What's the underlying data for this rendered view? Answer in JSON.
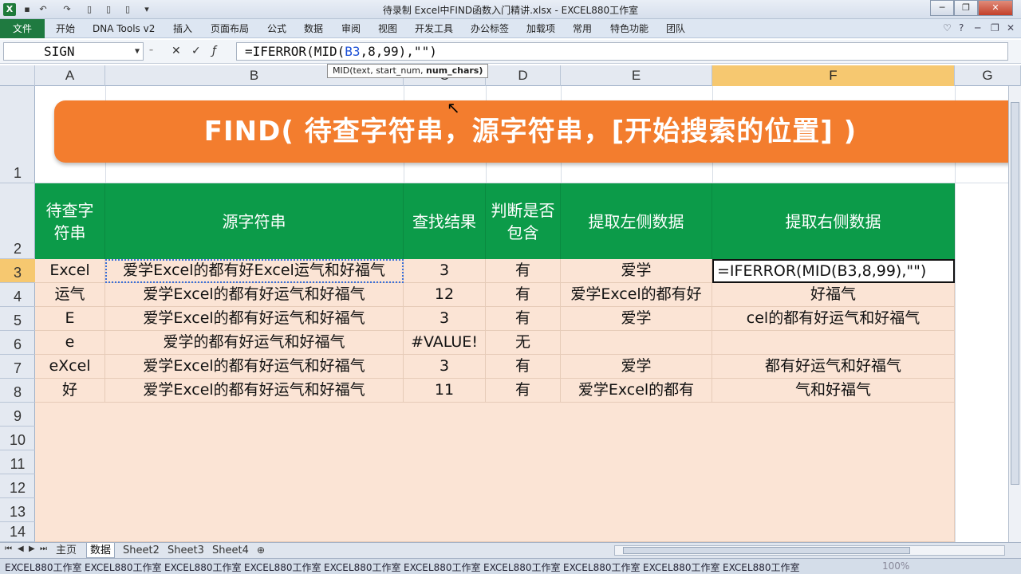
{
  "window": {
    "title": "待录制 Excel中FIND函数入门精讲.xlsx - EXCEL880工作室"
  },
  "menu": {
    "file": "文件",
    "items": [
      "开始",
      "DNA Tools v2",
      "插入",
      "页面布局",
      "公式",
      "数据",
      "审阅",
      "视图",
      "开发工具",
      "办公标签",
      "加载项",
      "常用",
      "特色功能",
      "团队"
    ]
  },
  "formula_bar": {
    "name_box": "SIGN",
    "formula_prefix": "=IFERROR(MID(",
    "formula_ref": "B3",
    "formula_suffix": ",8,99),\"\")"
  },
  "tooltip": {
    "text": "MID(text, start_num, ",
    "bold_part": "num_chars)"
  },
  "columns": [
    "A",
    "B",
    "C",
    "D",
    "E",
    "F",
    "G"
  ],
  "active_column": "F",
  "rows": [
    "1",
    "2",
    "3",
    "4",
    "5",
    "6",
    "7",
    "8",
    "9",
    "10",
    "11",
    "12",
    "13",
    "14"
  ],
  "active_row": "3",
  "banner": {
    "text": "FIND( 待查字符串，源字符串，[开始搜索的位置]   )"
  },
  "table": {
    "headers": [
      "待查字符串",
      "源字符串",
      "查找结果",
      "判断是否包含",
      "提取左侧数据",
      "提取右侧数据"
    ],
    "rows": [
      [
        "Excel",
        "爱学Excel的都有好Excel运气和好福气",
        "3",
        "有",
        "爱学",
        "=IFERROR(MID(B3,8,99),\"\")"
      ],
      [
        "运气",
        "爱学Excel的都有好运气和好福气",
        "12",
        "有",
        "爱学Excel的都有好",
        "好福气"
      ],
      [
        "E",
        "爱学Excel的都有好运气和好福气",
        "3",
        "有",
        "爱学",
        "cel的都有好运气和好福气"
      ],
      [
        "e",
        "爱学的都有好运气和好福气",
        "#VALUE!",
        "无",
        "",
        ""
      ],
      [
        "eXcel",
        "爱学Excel的都有好运气和好福气",
        "3",
        "有",
        "爱学",
        "都有好运气和好福气"
      ],
      [
        "好",
        "爱学Excel的都有好运气和好福气",
        "11",
        "有",
        "爱学Excel的都有",
        "气和好福气"
      ]
    ]
  },
  "sheets": [
    "主页",
    "数据",
    "Sheet2",
    "Sheet3",
    "Sheet4"
  ],
  "active_sheet": "数据",
  "status": {
    "watermark": "EXCEL880工作室",
    "zoom": "100%"
  },
  "colors": {
    "banner": "#f37d2e",
    "header_green": "#0c9b49",
    "cell_peach": "#fbe4d5"
  }
}
